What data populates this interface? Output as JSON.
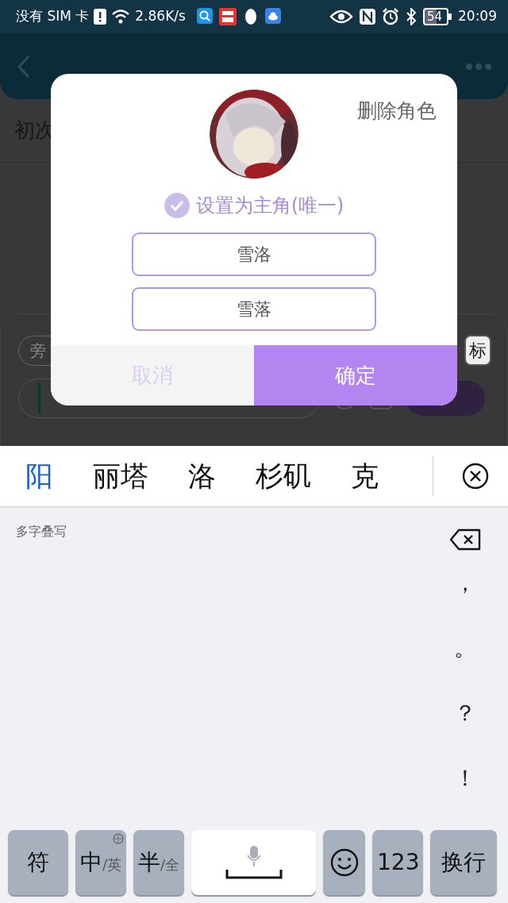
{
  "status_bar": {
    "carrier": "没有 SIM 卡",
    "speed": "2.86K/s",
    "battery": "54",
    "time": "20:09"
  },
  "background": {
    "heading": "初次",
    "chip": "旁",
    "tag_button": "标"
  },
  "dialog": {
    "delete": "删除角色",
    "main_role": {
      "label": "设置为主角(唯一)",
      "checked": true
    },
    "fields": [
      {
        "value": "雪洛"
      },
      {
        "value": "雪落"
      }
    ],
    "buttons": [
      {
        "label": "取消",
        "kind": "cancel"
      },
      {
        "label": "确定",
        "kind": "confirm"
      }
    ]
  },
  "keyboard": {
    "candidates": [
      {
        "text": "阳",
        "selected": true
      },
      {
        "text": "丽塔",
        "selected": false
      },
      {
        "text": "洛",
        "selected": false
      },
      {
        "text": "杉矶",
        "selected": false
      },
      {
        "text": "克",
        "selected": false
      }
    ],
    "mode_label": "多字叠写",
    "punctuation": [
      "，",
      "。",
      "？",
      "！"
    ],
    "keys": [
      {
        "kind": "text",
        "label": "符"
      },
      {
        "kind": "toggle",
        "label": "中",
        "alt": "/英"
      },
      {
        "kind": "toggle",
        "label": "半",
        "alt": "/全"
      },
      {
        "kind": "space"
      },
      {
        "kind": "emoji"
      },
      {
        "kind": "text",
        "label": "123"
      },
      {
        "kind": "text",
        "label": "换行"
      }
    ]
  }
}
